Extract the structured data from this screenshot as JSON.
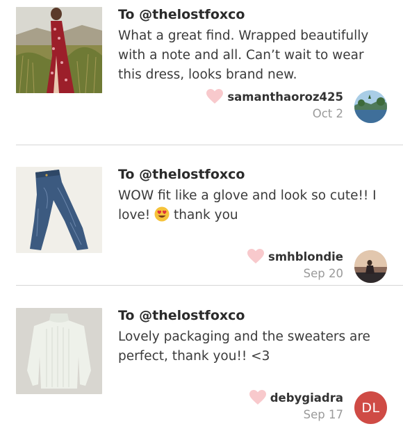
{
  "reviews": [
    {
      "to": "To @thelostfoxco",
      "message": "What a great find. Wrapped beautifully with a note and all. Can’t wait to wear this dress, looks brand new.",
      "username": "samanthaoroz425",
      "date": "Oct 2",
      "thumb_icon": "red-floral-dress-photo",
      "avatar_icon": "landscape-photo-avatar"
    },
    {
      "to": "To @thelostfoxco",
      "message_before": "WOW fit like a glove and look so cute!! I love!",
      "emoji": "heart-eyes-emoji",
      "message_after": " thank you",
      "username": "smhblondie",
      "date": "Sep 20",
      "thumb_icon": "blue-jeans-photo",
      "avatar_icon": "sunset-photo-avatar"
    },
    {
      "to": "To @thelostfoxco",
      "message": "Lovely packaging and the sweaters are perfect, thank you!! <3",
      "username": "debygiadra",
      "date": "Sep 17",
      "thumb_icon": "white-sweater-photo",
      "avatar_initials": "DL"
    }
  ],
  "colors": {
    "heart": "#f8c9cc",
    "initials_avatar": "#cf4b45",
    "date_text": "#9a9a9a",
    "divider": "#d6d6d6"
  }
}
